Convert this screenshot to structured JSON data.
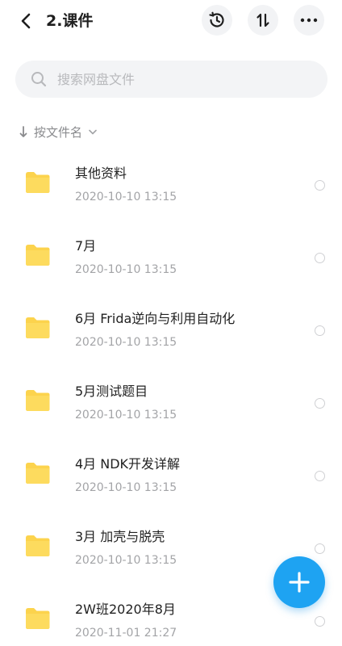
{
  "header": {
    "title": "2.课件",
    "back_icon": "chevron-left-icon",
    "history_icon": "history-icon",
    "sort_icon": "sort-arrows-icon",
    "more_icon": "more-horizontal-icon"
  },
  "search": {
    "placeholder": "搜索网盘文件",
    "value": ""
  },
  "sort": {
    "label": "按文件名"
  },
  "files": [
    {
      "name": "其他资料",
      "date": "2020-10-10  13:15"
    },
    {
      "name": "7月",
      "date": "2020-10-10  13:15"
    },
    {
      "name": "6月 Frida逆向与利用自动化",
      "date": "2020-10-10  13:15"
    },
    {
      "name": "5月测试题目",
      "date": "2020-10-10  13:15"
    },
    {
      "name": "4月 NDK开发详解",
      "date": "2020-10-10  13:15"
    },
    {
      "name": "3月 加壳与脱壳",
      "date": "2020-10-10  13:15"
    },
    {
      "name": "2W班2020年8月",
      "date": "2020-11-01  21:27"
    }
  ],
  "colors": {
    "folder": "#FCD34D",
    "fab": "#1EA3F2"
  },
  "fab": {
    "icon": "plus-icon"
  }
}
